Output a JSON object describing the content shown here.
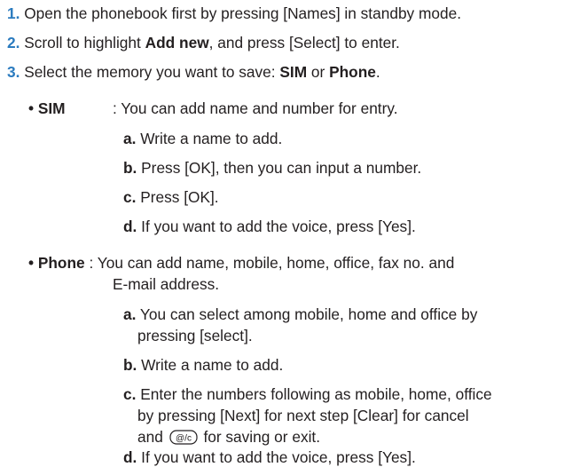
{
  "steps": [
    {
      "num": "1.",
      "text": "Open the phonebook first by pressing [Names] in standby mode."
    },
    {
      "num": "2.",
      "pre": "Scroll to highlight ",
      "bold": "Add new",
      "post": ", and press [Select] to enter."
    },
    {
      "num": "3.",
      "pre": "Select the memory you want to save: ",
      "bold1": "SIM",
      "mid": " or ",
      "bold2": "Phone",
      "post": "."
    }
  ],
  "sim": {
    "bullet": "• SIM",
    "desc": ": You can add name and number for entry.",
    "items": [
      {
        "letter": "a.",
        "text": " Write a name to add."
      },
      {
        "letter": "b.",
        "text": " Press [OK], then you can input a number."
      },
      {
        "letter": "c.",
        "text": " Press [OK]."
      },
      {
        "letter": "d.",
        "text": " If you want to add the voice, press [Yes]."
      }
    ]
  },
  "phone": {
    "bullet": "• Phone",
    "desc_line1": " : You can add name, mobile, home, office, fax no. and",
    "desc_line2": "E-mail address.",
    "items": [
      {
        "letter": "a.",
        "line1": " You can select among mobile, home and office by",
        "line2": "pressing [select]."
      },
      {
        "letter": "b.",
        "line1": " Write a name to add."
      },
      {
        "letter": "c.",
        "line1": " Enter the numbers following as mobile, home, office",
        "line2": "by pressing [Next] for next step [Clear] for cancel",
        "line3_pre": "and ",
        "icon": "end-clear-key-icon",
        "icon_label": "@/c",
        "line3_post": " for saving or exit."
      },
      {
        "letter": "d.",
        "line1": " If you want to add the voice, press [Yes]."
      }
    ]
  }
}
